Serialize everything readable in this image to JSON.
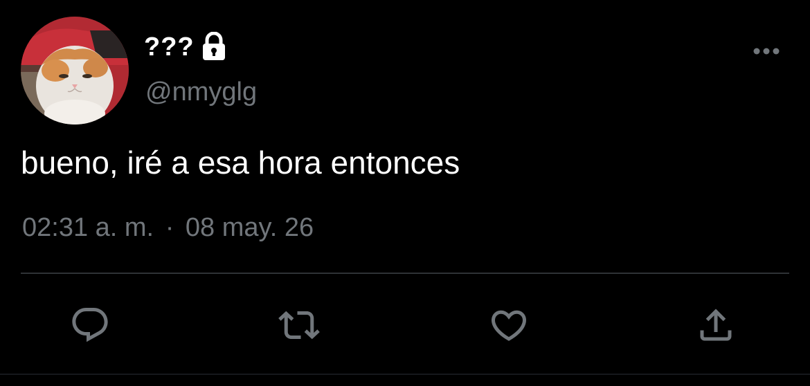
{
  "user": {
    "display_name": "???",
    "handle": "@nmyglg",
    "protected": true,
    "avatar_icon": "cat-avatar"
  },
  "tweet": {
    "text": "bueno, iré a esa hora entonces",
    "time": "02:31 a. m.",
    "separator": "·",
    "date": "08 may. 26"
  },
  "actions": [
    {
      "name": "reply",
      "icon": "reply-icon"
    },
    {
      "name": "retweet",
      "icon": "retweet-icon"
    },
    {
      "name": "like",
      "icon": "heart-icon"
    },
    {
      "name": "share",
      "icon": "share-icon"
    }
  ],
  "colors": {
    "background": "#000000",
    "text_primary": "#ffffff",
    "text_secondary": "#71767b",
    "divider": "#2f3336"
  }
}
